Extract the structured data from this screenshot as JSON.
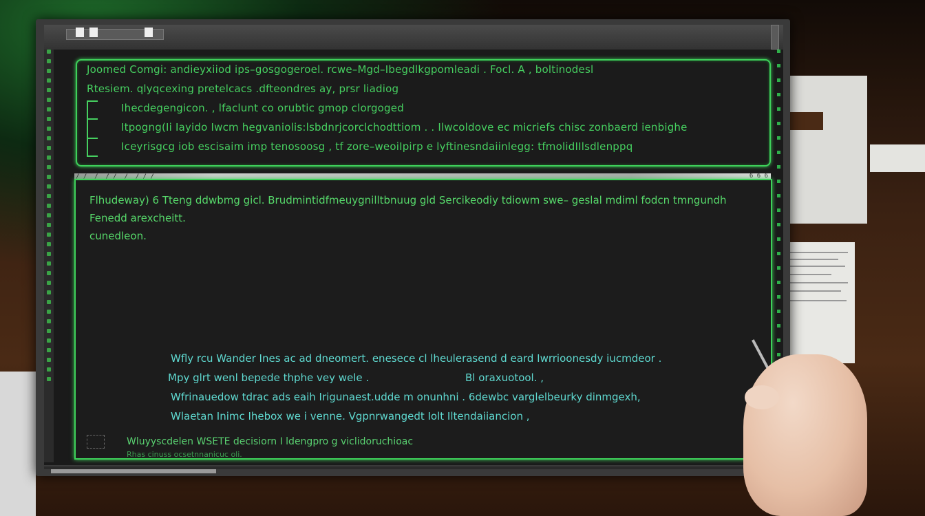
{
  "window": {
    "topbar_tag": "",
    "panel_header_tag": "/ /_ /_ /_/_ /_ /_/ /_",
    "panel_header_right": "6 6 6"
  },
  "top_panel": {
    "lines": [
      "Joomed Comgi: andieyxiiod  ips–gosgogeroel. rcwe–Mgd–Ibegdlkgpomleadi . Focl. A , boltinodesl",
      "Rtesiem. qlyqcexing  pretelcacs .dfteondres  ay, prsr liadiog",
      "Ihecdegengicon. , lfaclunt co orubtic  gmop  clorgoged",
      "Itpogng(Ii Iayido Iwcm hegvaniolis:lsbdnrjcorclchodttiom . . Ilwcoldove  ec micriefs chisc  zonbaerd ienbighe",
      "Iceyrisgcg iob  escisaim  imp  tenosoosg ,  tf  zore–weoiIpirp  e  lyftinesndaiinlegg: tfmolidIIlsdlenppq"
    ]
  },
  "main_panel": {
    "intro": [
      "Flhudeway) 6 Tteng ddwbmg  gicl. Brudmintidfmeuygnilltbnuug gld Sercikeodiy tdiowm swe– geslal mdiml  fodcn tmngundh",
      "Fenedd arexcheitt.",
      "cunedleon."
    ],
    "blue_lines": [
      "Wfly rcu Wander  Ines  ac ad  dneomert.  enesece  cl lheulerasend  d  eard  Iwrrioonesdy  iucmdeor .",
      "Mpy glrt wenl bepede  thphe vey  wele .",
      "Wfrinauedow  tdrac  ads  eaih  Irigunaest.udde  m  onunhni  .  6dewbc varglelbeurky dinmgexh,",
      "Wlaetan Inimc  Ihebox  we i  venne.   Vgpnrwangedt  Iolt  Iltendaiiancion  ,"
    ],
    "blue_side": "Bl oraxuotool. ,",
    "footer": "Wluyyscdelen WSETE decisiorn  I ldengpro g  viclidoruchioac",
    "footer_small": "Rhas cinuss   ocsetnnanicuc oli."
  }
}
